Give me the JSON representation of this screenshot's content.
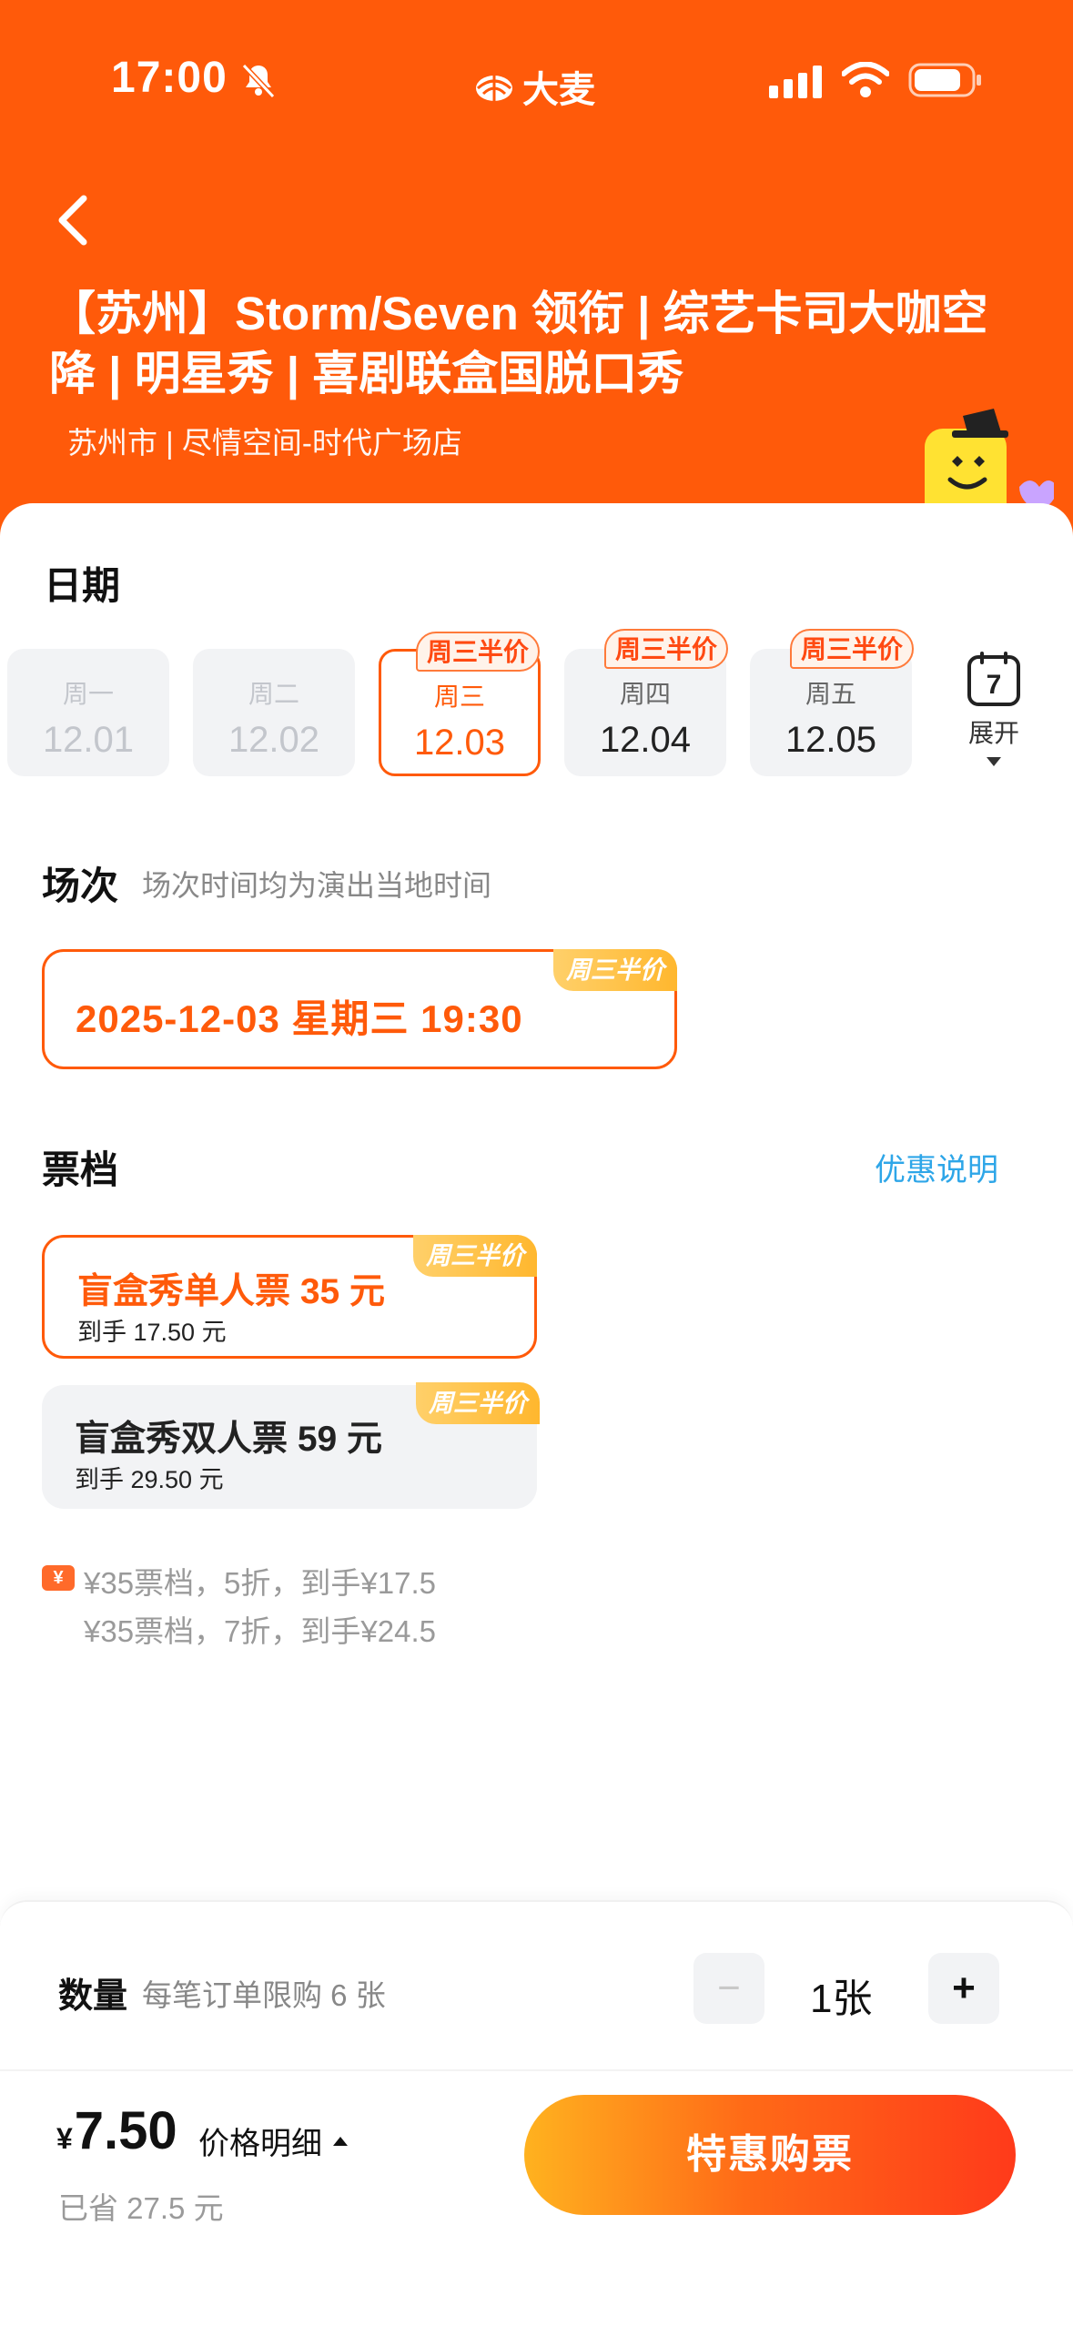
{
  "status": {
    "time": "17:00",
    "app_logo": "大麦"
  },
  "event": {
    "title": "【苏州】Storm/Seven 领衔 | 综艺卡司大咖空降 | 明星秀 | 喜剧联盒国脱口秀",
    "venue": "苏州市 | 尽情空间-时代广场店"
  },
  "dates": {
    "heading": "日期",
    "items": [
      {
        "dow": "周一",
        "date": "12.01",
        "state": "disabled",
        "badge": ""
      },
      {
        "dow": "周二",
        "date": "12.02",
        "state": "disabled",
        "badge": ""
      },
      {
        "dow": "周三",
        "date": "12.03",
        "state": "selected",
        "badge": "周三半价"
      },
      {
        "dow": "周四",
        "date": "12.04",
        "state": "normal",
        "badge": "周三半价"
      },
      {
        "dow": "周五",
        "date": "12.05",
        "state": "normal",
        "badge": "周三半价"
      }
    ],
    "expand_label": "展开",
    "calendar_day": "7"
  },
  "sessions": {
    "heading": "场次",
    "subheading": "场次时间均为演出当地时间",
    "items": [
      {
        "label": "2025-12-03 星期三 19:30",
        "badge": "周三半价"
      }
    ]
  },
  "tickets": {
    "heading": "票档",
    "promo_link": "优惠说明",
    "items": [
      {
        "name": "盲盒秀单人票 35 元",
        "final": "到手 17.50 元",
        "badge": "周三半价",
        "selected": true
      },
      {
        "name": "盲盒秀双人票 59 元",
        "final": "到手 29.50 元",
        "badge": "周三半价",
        "selected": false
      }
    ],
    "discount_icon": "¥",
    "discounts": [
      "¥35票档，5折，到手¥17.5",
      "¥35票档，7折，到手¥24.5"
    ]
  },
  "quantity": {
    "label": "数量",
    "limit": "每笔订单限购 6 张",
    "value": "1张",
    "minus": "−",
    "plus": "+"
  },
  "purchase": {
    "currency": "¥",
    "price": "7.50",
    "detail_label": "价格明细",
    "saved": "已省 27.5 元",
    "button": "特惠购票"
  },
  "colors": {
    "brand": "#ff5a0a",
    "link": "#2ea6e8",
    "badge_gold": "#ffb72e"
  }
}
